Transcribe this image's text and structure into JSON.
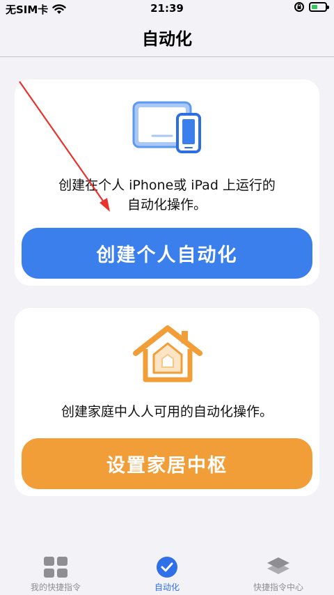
{
  "status_bar": {
    "carrier": "无SIM卡",
    "time": "21:39"
  },
  "nav": {
    "title": "自动化"
  },
  "personal_card": {
    "icon": "iphone-ipad-icon",
    "description_line1": "创建在个人 iPhone或 iPad 上运行的",
    "description_line2": "自动化操作。",
    "button_label": "创建个人自动化",
    "button_color": "#3a7fec"
  },
  "home_card": {
    "icon": "home-icon",
    "description": "创建家庭中人人可用的自动化操作。",
    "button_label": "设置家居中枢",
    "button_color": "#f19e38"
  },
  "tab_bar": {
    "tabs": [
      {
        "label": "我的快捷指令",
        "icon": "grid-icon",
        "active": false
      },
      {
        "label": "自动化",
        "icon": "automation-check-icon",
        "active": true
      },
      {
        "label": "快捷指令中心",
        "icon": "gallery-layers-icon",
        "active": false
      }
    ]
  },
  "colors": {
    "accent": "#2f6fe8",
    "annotation_arrow": "#e8322c"
  }
}
